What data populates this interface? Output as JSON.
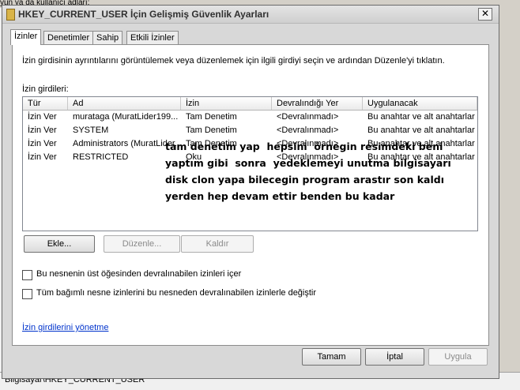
{
  "background": {
    "fragment": "yun ya da kullanıcı adları:",
    "status_path": "Bilgisayar\\HKEY_CURRENT_USER"
  },
  "window": {
    "title": "HKEY_CURRENT_USER İçin Gelişmiş Güvenlik Ayarları",
    "close_glyph": "✕"
  },
  "tabs": [
    {
      "label": "İzinler",
      "active": true
    },
    {
      "label": "Denetimler",
      "active": false
    },
    {
      "label": "Sahip",
      "active": false
    },
    {
      "label": "Etkili İzinler",
      "active": false
    }
  ],
  "permissions": {
    "description": "İzin girdisinin ayrıntılarını görüntülemek veya düzenlemek için ilgili girdiyi seçin ve ardından Düzenle'yi tıklatın.",
    "entries_label": "İzin girdileri:",
    "columns": [
      "Tür",
      "Ad",
      "İzin",
      "Devralındığı Yer",
      "Uygulanacak"
    ],
    "rows": [
      [
        "İzin Ver",
        "murataga (MuratLider199...",
        "Tam Denetim",
        "<Devralınmadı>",
        "Bu anahtar ve alt anahtarlar"
      ],
      [
        "İzin Ver",
        "SYSTEM",
        "Tam Denetim",
        "<Devralınmadı>",
        "Bu anahtar ve alt anahtarlar"
      ],
      [
        "İzin Ver",
        "Administrators (MuratLider...",
        "Tam Denetim",
        "<Devralınmadı>",
        "Bu anahtar ve alt anahtarlar"
      ],
      [
        "İzin Ver",
        "RESTRICTED",
        "Oku",
        "<Devralınmadı>",
        "Bu anahtar ve alt anahtarlar"
      ]
    ],
    "overlay_note": "tam denetim yap  hepsini  örnegin resimdeki beni\nyaptım gibi  sonra  yedeklemeyi unutma bilgisayarı\ndisk clon yapa bilecegin program arastır son kaldı\nyerden hep devam ettir benden bu kadar",
    "buttons": {
      "add": "Ekle...",
      "edit": "Düzenle...",
      "remove": "Kaldır"
    },
    "checkboxes": [
      {
        "label": "Bu nesnenin üst öğesinden devralınabilen izinleri içer",
        "checked": false
      },
      {
        "label": "Tüm bağımlı nesne izinlerini bu nesneden devralınabilen izinlerle değiştir",
        "checked": false
      }
    ],
    "manage_link": "İzin girdilerini yönetme"
  },
  "footer": {
    "ok": "Tamam",
    "cancel": "İptal",
    "apply": "Uygula"
  }
}
